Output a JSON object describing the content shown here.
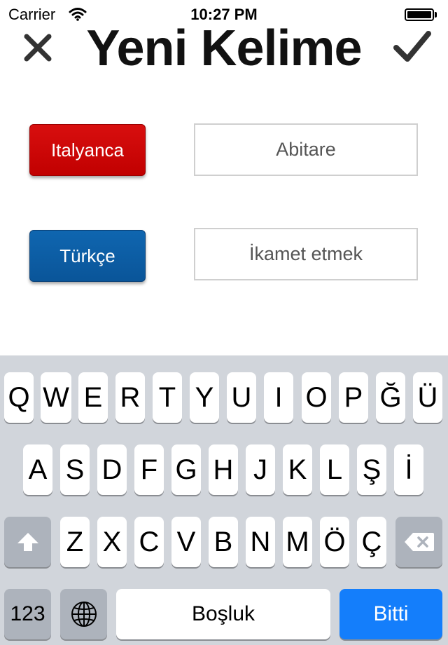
{
  "status_bar": {
    "carrier": "Carrier",
    "time": "10:27 PM",
    "wifi_icon": "wifi-icon",
    "battery_icon": "battery-icon"
  },
  "header": {
    "title": "Yeni Kelime",
    "close_icon": "close-icon",
    "confirm_icon": "checkmark-icon"
  },
  "form": {
    "source_language": "Italyanca",
    "source_word": "Abitare",
    "target_language": "Türkçe",
    "target_word": "İkamet etmek",
    "colors": {
      "source_button": "#d10505",
      "target_button": "#0d5fa6"
    }
  },
  "keyboard": {
    "row1": [
      "Q",
      "W",
      "E",
      "R",
      "T",
      "Y",
      "U",
      "I",
      "O",
      "P",
      "Ğ",
      "Ü"
    ],
    "row2": [
      "A",
      "S",
      "D",
      "F",
      "G",
      "H",
      "J",
      "K",
      "L",
      "Ş",
      "İ"
    ],
    "row3": [
      "Z",
      "X",
      "C",
      "V",
      "B",
      "N",
      "M",
      "Ö",
      "Ç"
    ],
    "numbers_label": "123",
    "space_label": "Boşluk",
    "done_label": "Bitti",
    "shift_icon": "shift-icon",
    "backspace_icon": "backspace-icon",
    "globe_icon": "globe-icon",
    "colors": {
      "background": "#d1d5db",
      "done_key": "#147efb"
    }
  }
}
